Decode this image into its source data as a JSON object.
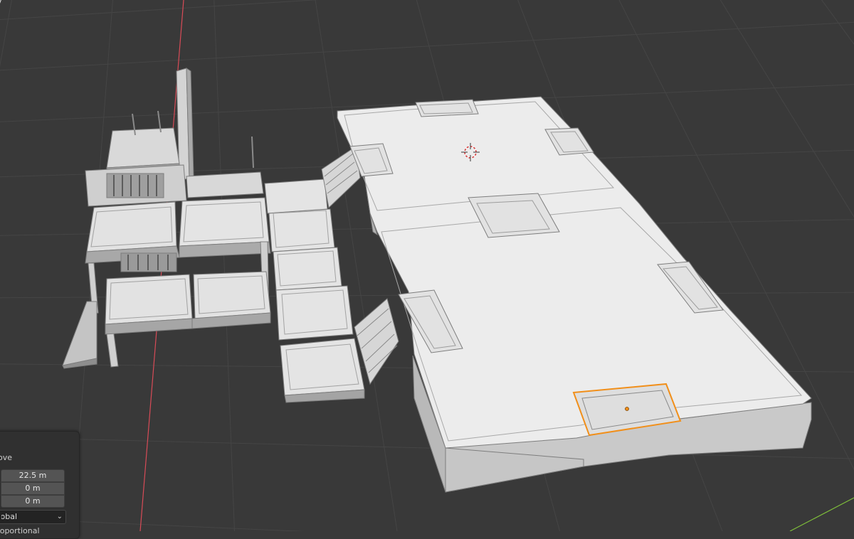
{
  "app": {
    "corner_label": "y"
  },
  "redo_panel": {
    "heading": "Move",
    "move_x": "22.5 m",
    "move_y": "0 m",
    "move_z": "0 m",
    "orientation": "Global",
    "footer": "Proportional Editing"
  },
  "viewport": {
    "background": "#393939",
    "grid_color": "#454545",
    "x_axis_color": "#d84b57",
    "y_axis_color": "#7fbf3a",
    "selection_color": "#f18f1a",
    "model_light": "#e8e8e8",
    "model_mid": "#cfcfcf",
    "model_dark": "#9a9a9a"
  }
}
